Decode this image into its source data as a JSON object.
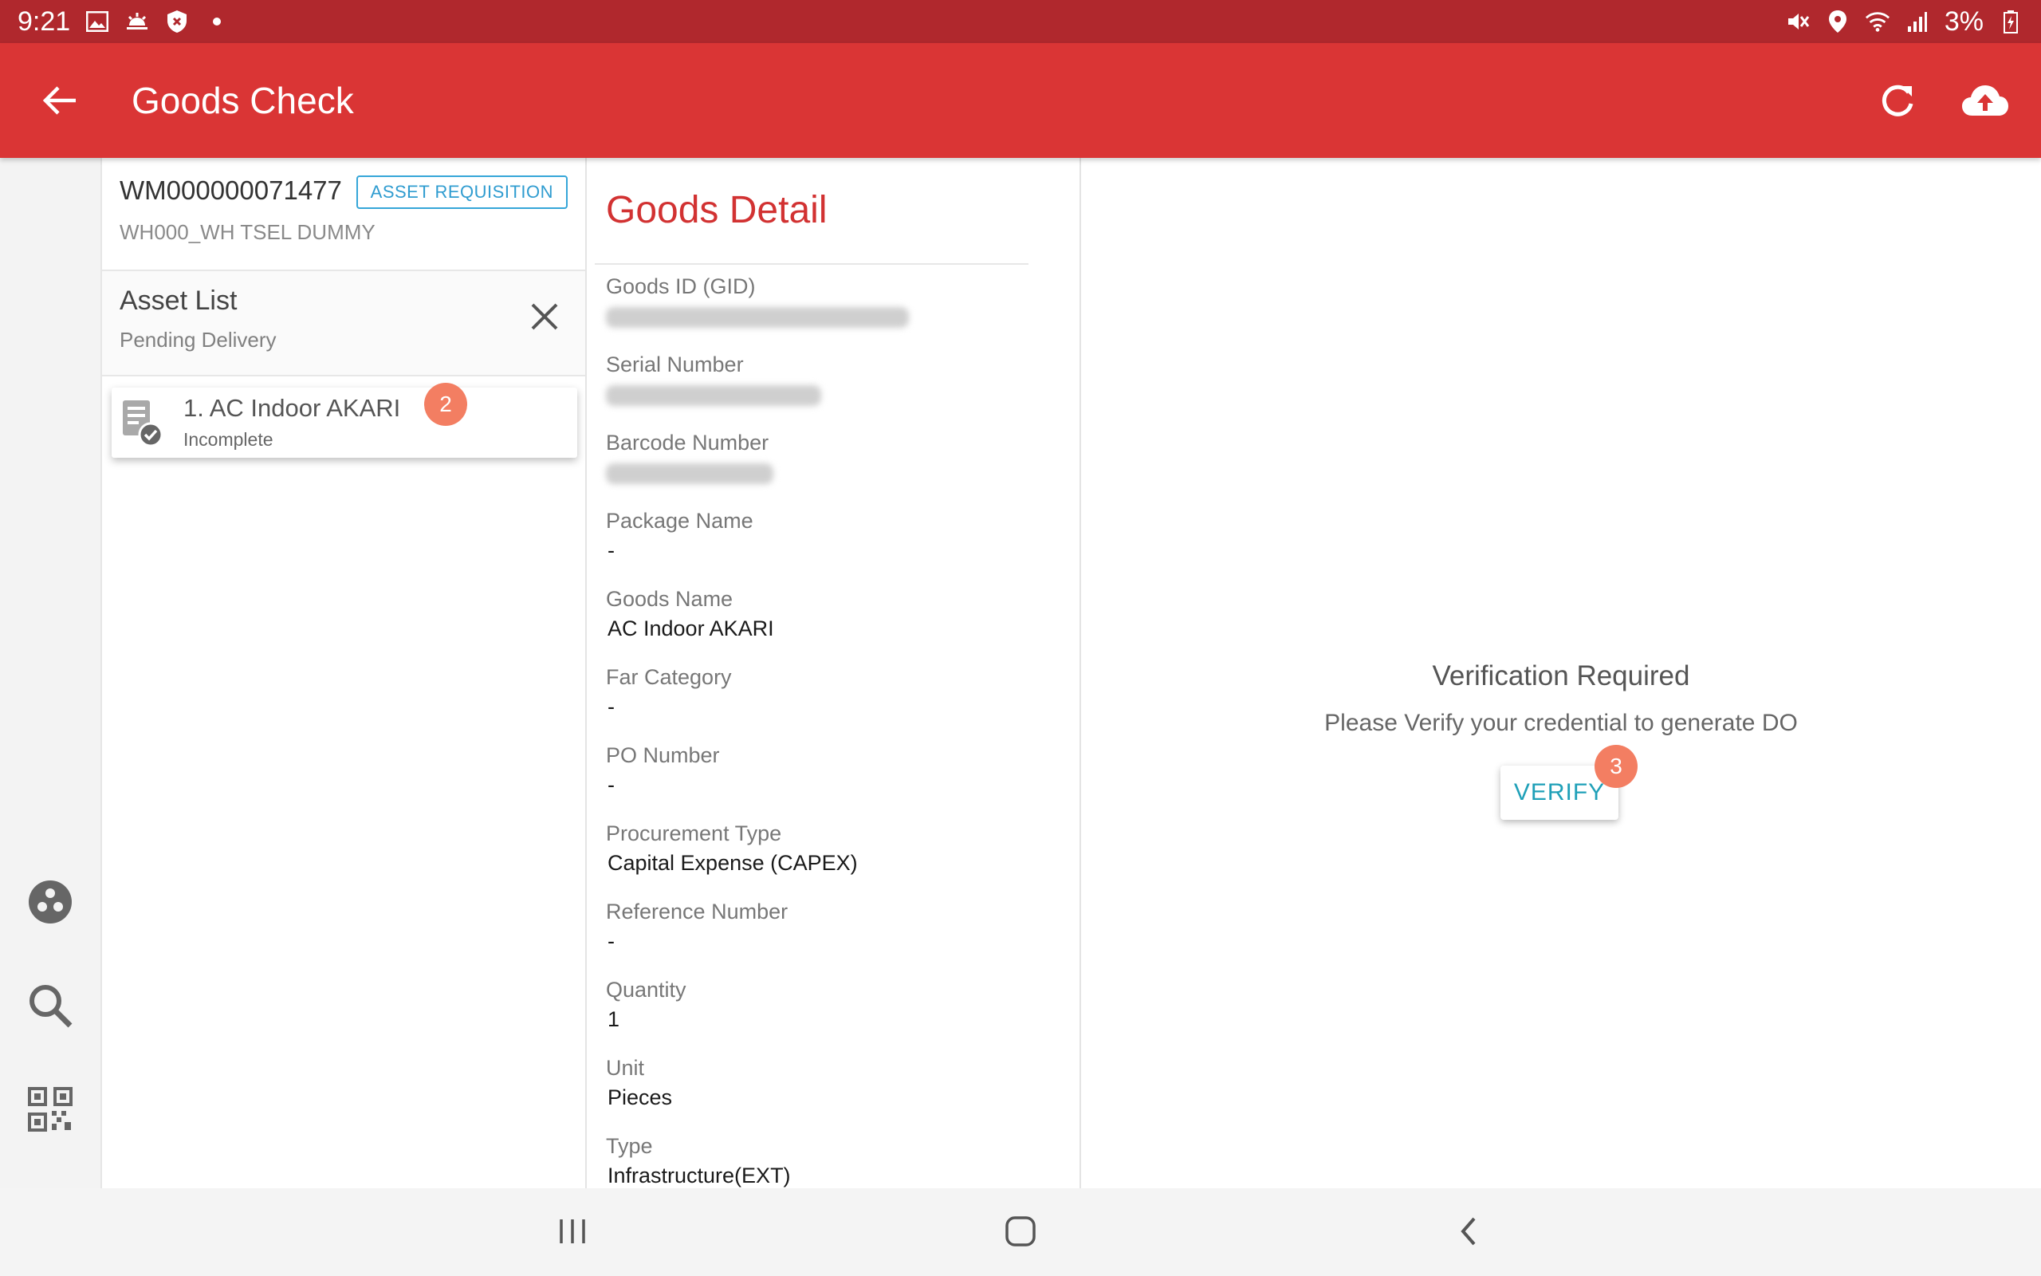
{
  "status_bar": {
    "time": "9:21",
    "battery": "3%",
    "left_icons": [
      "image-icon",
      "weather-icon",
      "shield-icon",
      "dot-icon"
    ],
    "right_icons": [
      "mute-icon",
      "location-icon",
      "wifi-icon",
      "signal-icon",
      "battery-icon"
    ]
  },
  "app_bar": {
    "title": "Goods Check",
    "color": "#da3535",
    "icons": [
      "back-arrow-icon",
      "refresh-icon",
      "cloud-upload-icon"
    ]
  },
  "warehouse": {
    "code": "WM000000071477",
    "tag": "ASSET REQUISITION",
    "name": "WH000_WH TSEL DUMMY"
  },
  "asset_list": {
    "title": "Asset List",
    "subtitle": "Pending Delivery",
    "items": [
      {
        "name": "1. AC Indoor AKARI",
        "status": "Incomplete",
        "badge": "2"
      }
    ]
  },
  "goods_detail": {
    "title": "Goods Detail",
    "fields": [
      {
        "label": "Goods ID (GID)",
        "value": "",
        "blurred": true
      },
      {
        "label": "Serial Number",
        "value": "",
        "blurred": true
      },
      {
        "label": "Barcode Number",
        "value": "",
        "blurred": true
      },
      {
        "label": "Package Name",
        "value": "-"
      },
      {
        "label": "Goods Name",
        "value": "AC Indoor AKARI"
      },
      {
        "label": "Far Category",
        "value": "-"
      },
      {
        "label": "PO Number",
        "value": "-"
      },
      {
        "label": "Procurement Type",
        "value": "Capital Expense (CAPEX)"
      },
      {
        "label": "Reference Number",
        "value": "-"
      },
      {
        "label": "Quantity",
        "value": "1"
      },
      {
        "label": "Unit",
        "value": "Pieces"
      },
      {
        "label": "Type",
        "value": "Infrastructure(EXT)"
      }
    ]
  },
  "verification": {
    "title": "Verification Required",
    "message": "Please Verify your credential to generate DO",
    "button_label": "VERIFY",
    "badge": "3"
  },
  "colors": {
    "status_bar": "#b0282d",
    "accent_red": "#d23232",
    "badge": "#f37e62",
    "verify_text": "#1fa0b8",
    "tag_blue": "#2f9cd0"
  }
}
